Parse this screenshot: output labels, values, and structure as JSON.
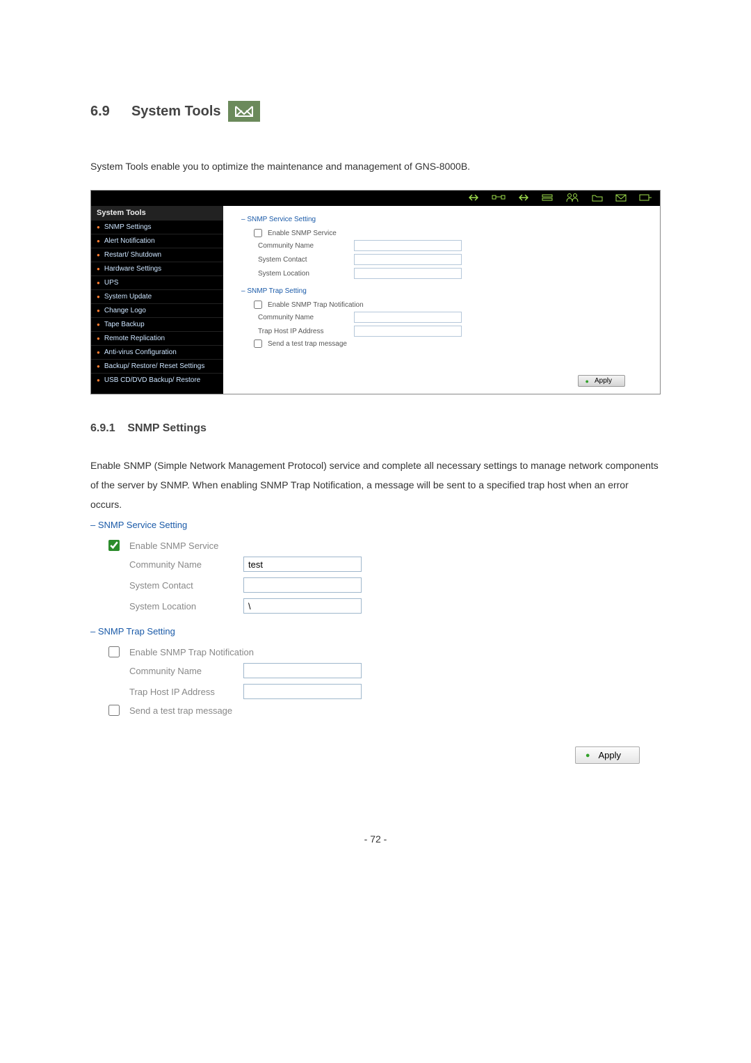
{
  "heading": {
    "num": "6.9",
    "title": "System Tools"
  },
  "intro": "System Tools enable you to optimize the maintenance and management of GNS-8000B.",
  "shot1": {
    "sidebar_title": "System Tools",
    "items": [
      "SNMP Settings",
      "Alert Notification",
      "Restart/ Shutdown",
      "Hardware Settings",
      "UPS",
      "System Update",
      "Change Logo",
      "Tape Backup",
      "Remote Replication",
      "Anti-virus Configuration",
      "Backup/ Restore/ Reset Settings",
      "USB CD/DVD Backup/ Restore"
    ],
    "svc_title": "SNMP Service Setting",
    "svc_enable": "Enable SNMP Service",
    "community": "Community Name",
    "contact": "System Contact",
    "location": "System Location",
    "trap_title": "SNMP Trap Setting",
    "trap_enable": "Enable SNMP Trap Notification",
    "trap_host": "Trap Host IP Address",
    "send_test": "Send a test trap message",
    "apply": "Apply"
  },
  "sub": {
    "num": "6.9.1",
    "title": "SNMP Settings"
  },
  "para": "Enable SNMP (Simple Network Management Protocol) service and complete all necessary settings to manage network components of the server by SNMP.  When enabling SNMP Trap Notification, a message will be sent to a specified trap host when an error occurs.",
  "shot2": {
    "svc_title": "SNMP Service Setting",
    "svc_enable": "Enable SNMP Service",
    "community": "Community Name",
    "community_val": "test",
    "contact": "System Contact",
    "location": "System Location",
    "location_val": "\\",
    "trap_title": "SNMP Trap Setting",
    "trap_enable": "Enable SNMP Trap Notification",
    "trap_host": "Trap Host IP Address",
    "send_test": "Send a test trap message",
    "apply": "Apply"
  },
  "page": "- 72 -"
}
